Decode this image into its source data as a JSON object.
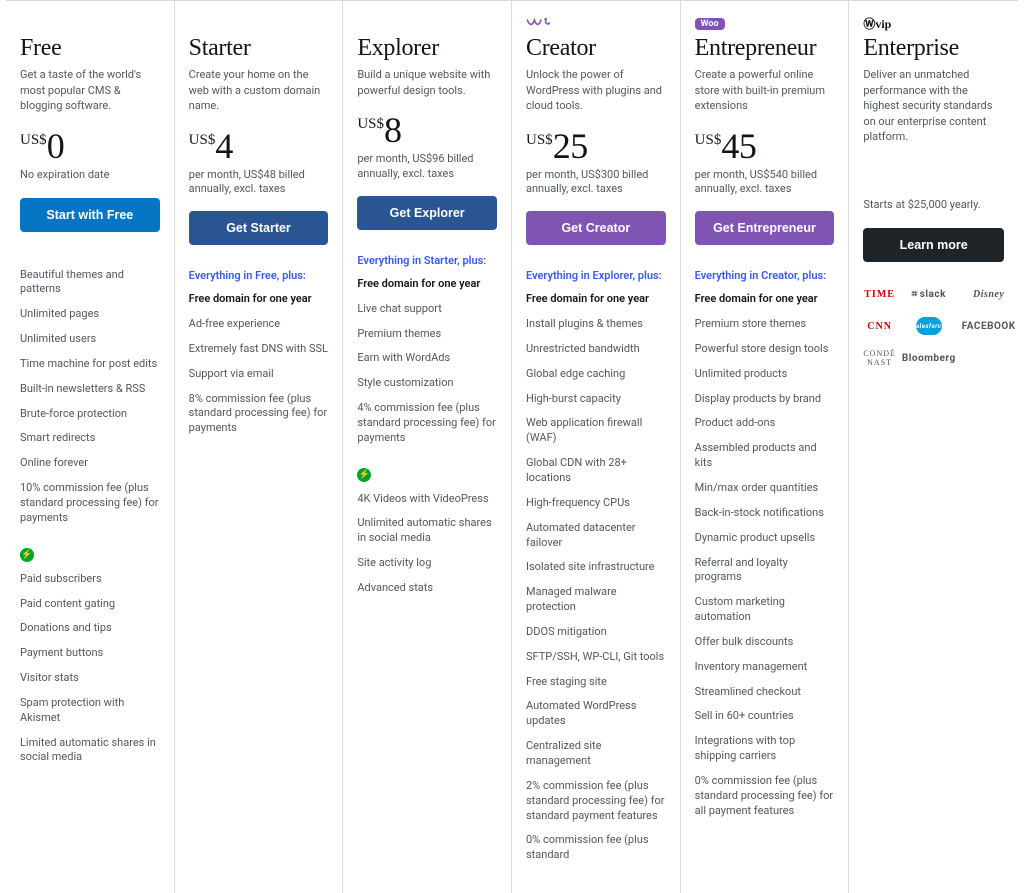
{
  "plans": [
    {
      "badge": "",
      "title": "Free",
      "subtitle": "Get a taste of the world's most popular CMS & blogging software.",
      "currency": "US$",
      "amount": "0",
      "billing": "No expiration date",
      "cta": "Start with Free",
      "cta_style": "cta-blue",
      "plus": "",
      "groups": [
        [
          "Beautiful themes and patterns",
          "Unlimited pages",
          "Unlimited users",
          "Time machine for post edits",
          "Built-in newsletters & RSS",
          "Brute-force protection",
          "Smart redirects",
          "Online forever",
          "10% commission fee (plus standard processing fee) for payments"
        ],
        [
          "Paid subscribers",
          "Paid content gating",
          "Donations and tips",
          "Payment buttons",
          "Visitor stats",
          "Spam protection with Akismet",
          "Limited automatic shares in social media"
        ]
      ]
    },
    {
      "badge": "",
      "title": "Starter",
      "subtitle": "Create your home on the web with a custom domain name.",
      "currency": "US$",
      "amount": "4",
      "billing": "per month, US$48 billed annually, excl. taxes",
      "cta": "Get Starter",
      "cta_style": "cta-navy",
      "plus": "Everything in Free, plus:",
      "groups": [
        [
          "*Free domain for one year",
          "Ad-free experience",
          "Extremely fast DNS with SSL",
          "Support via email",
          "8% commission fee (plus standard processing fee) for payments"
        ]
      ]
    },
    {
      "badge": "",
      "title": "Explorer",
      "subtitle": "Build a unique website with powerful design tools.",
      "currency": "US$",
      "amount": "8",
      "billing": "per month, US$96 billed annually, excl. taxes",
      "cta": "Get Explorer",
      "cta_style": "cta-navy",
      "plus": "Everything in Starter, plus:",
      "groups": [
        [
          "*Free domain for one year",
          "Live chat support",
          "Premium themes",
          "Earn with WordAds",
          "Style customization",
          "4% commission fee (plus standard processing fee) for payments"
        ],
        [
          "4K Videos with VideoPress",
          "Unlimited automatic shares in social media",
          "Site activity log",
          "Advanced stats"
        ]
      ]
    },
    {
      "badge": "wp-squiggle",
      "title": "Creator",
      "subtitle": "Unlock the power of WordPress with plugins and cloud tools.",
      "currency": "US$",
      "amount": "25",
      "billing": "per month, US$300 billed annually, excl. taxes",
      "cta": "Get Creator",
      "cta_style": "cta-purple",
      "plus": "Everything in Explorer, plus:",
      "groups": [
        [
          "*Free domain for one year",
          "Install plugins & themes",
          "Unrestricted bandwidth",
          "Global edge caching",
          "High-burst capacity",
          "Web application firewall (WAF)",
          "Global CDN with 28+ locations",
          "High-frequency CPUs",
          "Automated datacenter failover",
          "Isolated site infrastructure",
          "Managed malware protection",
          "DDOS mitigation",
          "SFTP/SSH, WP-CLI, Git tools",
          "Free staging site",
          "Automated WordPress updates",
          "Centralized site management",
          "2% commission fee (plus standard processing fee) for standard payment features",
          "0% commission fee (plus standard"
        ]
      ]
    },
    {
      "badge": "woo",
      "title": "Entrepreneur",
      "subtitle": "Create a powerful online store with built-in premium extensions",
      "currency": "US$",
      "amount": "45",
      "billing": "per month, US$540 billed annually, excl. taxes",
      "cta": "Get Entrepreneur",
      "cta_style": "cta-purple",
      "plus": "Everything in Creator, plus:",
      "groups": [
        [
          "*Free domain for one year",
          "Premium store themes",
          "Powerful store design tools",
          "Unlimited products",
          "Display products by brand",
          "Product add-ons",
          "Assembled products and kits",
          "Min/max order quantities",
          "Back-in-stock notifications",
          "Dynamic product upsells",
          "Referral and loyalty programs",
          "Custom marketing automation",
          "Offer bulk discounts",
          "Inventory management",
          "Streamlined checkout",
          "Sell in 60+ countries",
          "Integrations with top shipping carriers",
          "0% commission fee (plus standard processing fee) for all payment features"
        ]
      ]
    },
    {
      "badge": "vip",
      "title": "Enterprise",
      "subtitle": "Deliver an unmatched performance with the highest security standards on our enterprise content platform.",
      "currency": "",
      "amount": "",
      "billing": "Starts at $25,000 yearly.",
      "cta": "Learn more",
      "cta_style": "cta-dark",
      "plus": "",
      "groups": []
    }
  ],
  "enterprise_brands": [
    "TIME",
    "slack",
    "Disney",
    "CNN",
    "salesforce",
    "FACEBOOK",
    "CONDÉ NAST",
    "Bloomberg"
  ],
  "woo_label": "Woo",
  "vip_label": "Ⓦvip"
}
